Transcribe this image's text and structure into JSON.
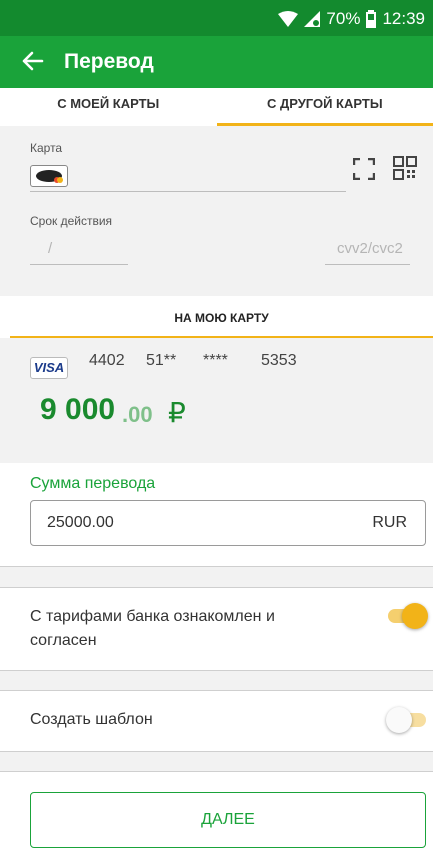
{
  "status_bar": {
    "battery": "70%",
    "time": "12:39"
  },
  "app_bar": {
    "title": "Перевод"
  },
  "tabs": [
    {
      "label": "С МОЕЙ КАРТЫ",
      "active": false
    },
    {
      "label": "С ДРУГОЙ КАРТЫ",
      "active": true
    }
  ],
  "card_form": {
    "card_label": "Карта",
    "expiry_label": "Срок действия",
    "expiry_placeholder": "/",
    "cvv_placeholder": "cvv2/cvc2"
  },
  "target": {
    "tab_label": "НА МОЮ КАРТУ",
    "card_brand": "VISA",
    "card_number": [
      "4402",
      "51**",
      "****",
      "5353"
    ],
    "balance_int": "9 000",
    "balance_dec": ".00",
    "currency_symbol": "₽"
  },
  "amount": {
    "label": "Сумма перевода",
    "value": "25000.00",
    "currency": "RUR"
  },
  "agreement": {
    "label": "С тарифами банка ознакомлен и согласен",
    "on": true
  },
  "template": {
    "label": "Создать шаблон",
    "on": false
  },
  "next_button": {
    "label": "ДАЛЕЕ"
  },
  "colors": {
    "primary": "#1aa33a",
    "dark_primary": "#138a2e",
    "accent": "#f2b318"
  }
}
